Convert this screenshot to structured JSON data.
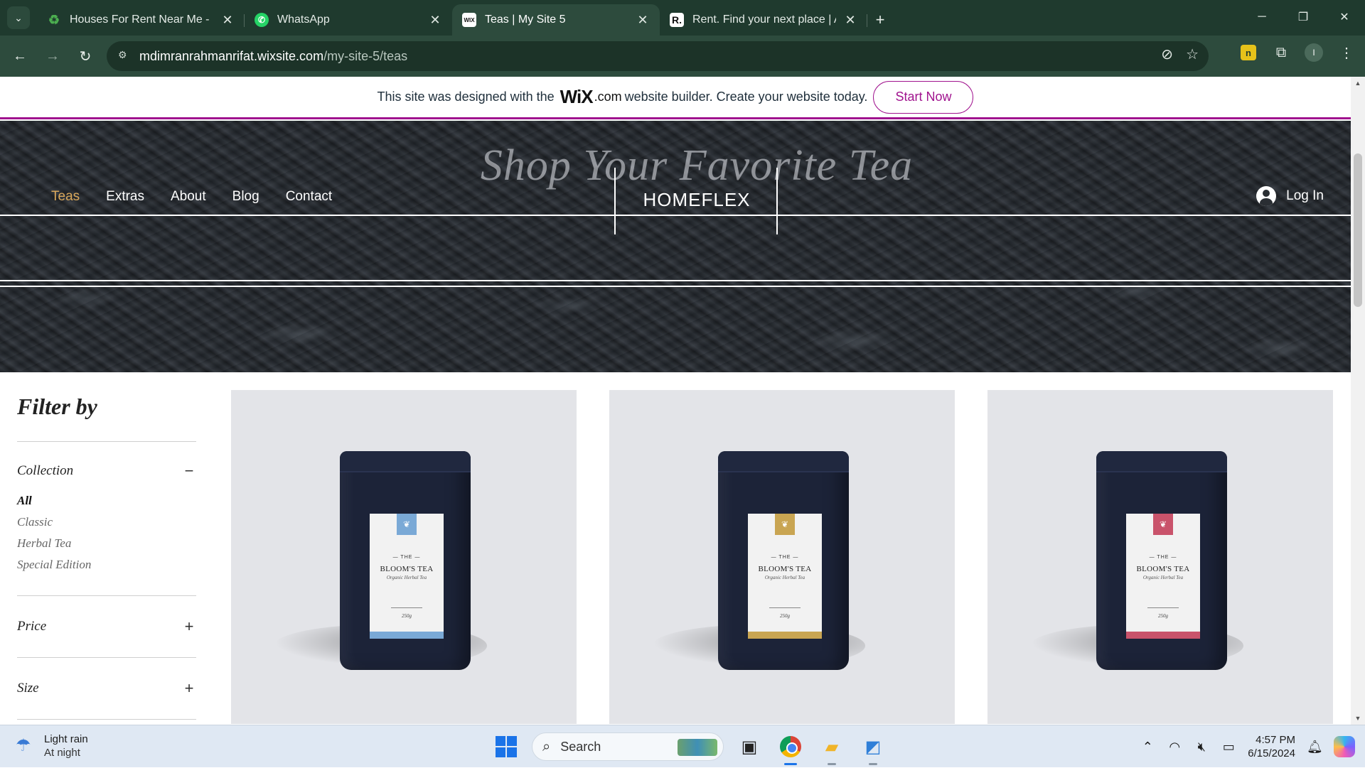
{
  "browser": {
    "tabs": [
      {
        "title": "Houses For Rent Near Me - Find",
        "favicon": "green-recycle-icon",
        "color": "#4caf50"
      },
      {
        "title": "WhatsApp",
        "favicon": "whatsapp-icon",
        "color": "#25d366"
      },
      {
        "title": "Teas | My Site 5",
        "favicon": "wix-icon",
        "color": "#ffffff"
      },
      {
        "title": "Rent. Find your next place | Apa",
        "favicon": "rent-r-icon",
        "color": "#ffffff"
      }
    ],
    "active_tab_index": 2,
    "url_host": "mdimranrahmanrifat.wixsite.com",
    "url_path": "/my-site-5/teas"
  },
  "wix_banner": {
    "text_before": "This site was designed with the",
    "logo": "WiX",
    "logo_suffix": ".com",
    "text_after": "website builder. Create your website today.",
    "button": "Start Now",
    "accent": "#a0138e"
  },
  "site": {
    "headline": "Shop Your Favorite Tea",
    "brand": "HOMEFLEX",
    "nav": [
      "Teas",
      "Extras",
      "About",
      "Blog",
      "Contact"
    ],
    "nav_active": "Teas",
    "login": "Log In"
  },
  "filter": {
    "title": "Filter by",
    "sections": {
      "collection": {
        "label": "Collection",
        "toggle": "−"
      },
      "price": {
        "label": "Price",
        "toggle": "+"
      },
      "size": {
        "label": "Size",
        "toggle": "+"
      }
    },
    "collections": [
      "All",
      "Classic",
      "Herbal Tea",
      "Special Edition"
    ],
    "selected_collection": "All"
  },
  "products": [
    {
      "the": "— THE —",
      "name": "BLOOM'S TEA",
      "sub": "Organic Herbal Tea",
      "weight": "250g",
      "accent": "#7aa9d6"
    },
    {
      "the": "— THE —",
      "name": "BLOOM'S TEA",
      "sub": "Organic Herbal Tea",
      "weight": "250g",
      "accent": "#c9a552"
    },
    {
      "the": "— THE —",
      "name": "BLOOM'S TEA",
      "sub": "Organic Herbal Tea",
      "weight": "250g",
      "accent": "#c9536b"
    }
  ],
  "taskbar": {
    "weather_title": "Light rain",
    "weather_sub": "At night",
    "search_placeholder": "Search",
    "time": "4:57 PM",
    "date": "6/15/2024"
  }
}
